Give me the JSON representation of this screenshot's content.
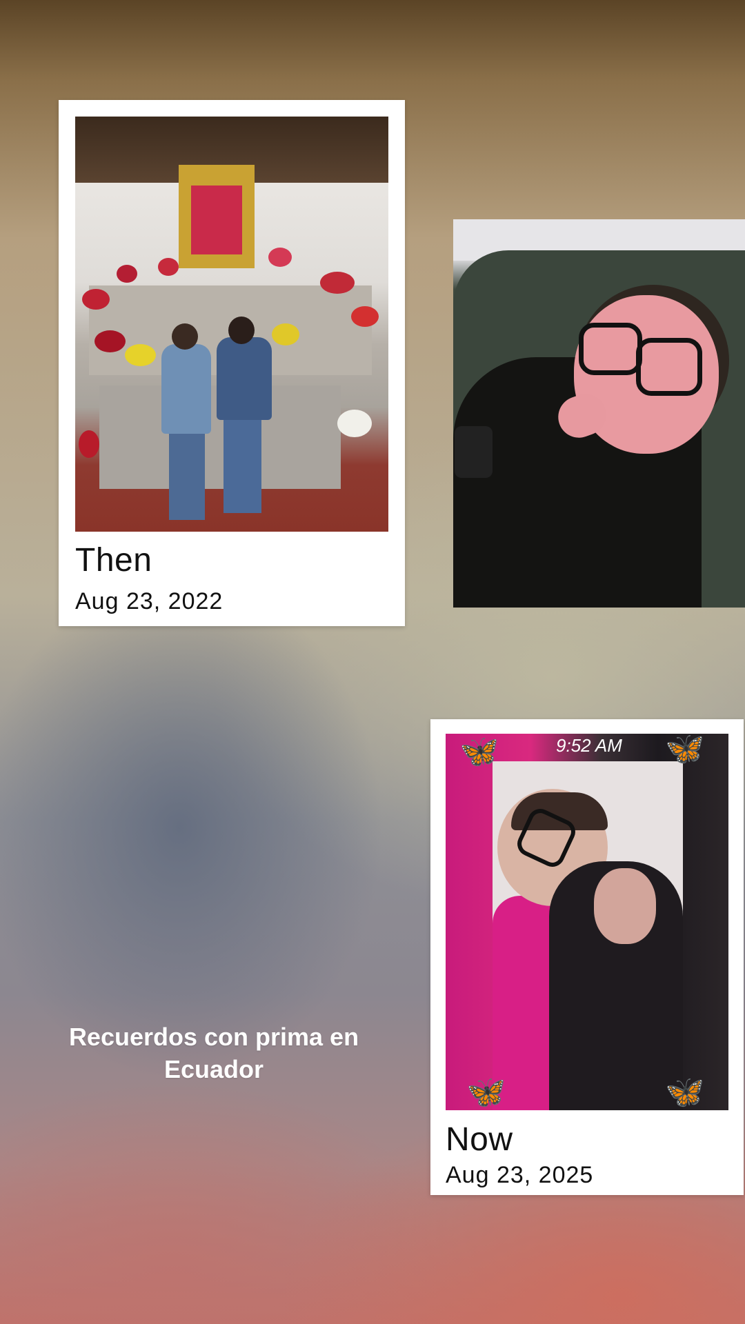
{
  "story": {
    "caption_text": "Recuerdos con prima en Ecuador"
  },
  "then_card": {
    "title": "Then",
    "date": "Aug 23, 2022"
  },
  "now_card": {
    "title": "Now",
    "date": "Aug 23, 2025",
    "photo_time": "9:52 AM"
  },
  "colors": {
    "card_background": "#ffffff",
    "butterfly": "#2aa7e8",
    "text_dark": "#111111"
  },
  "icons": {
    "butterfly": "butterfly-icon"
  }
}
